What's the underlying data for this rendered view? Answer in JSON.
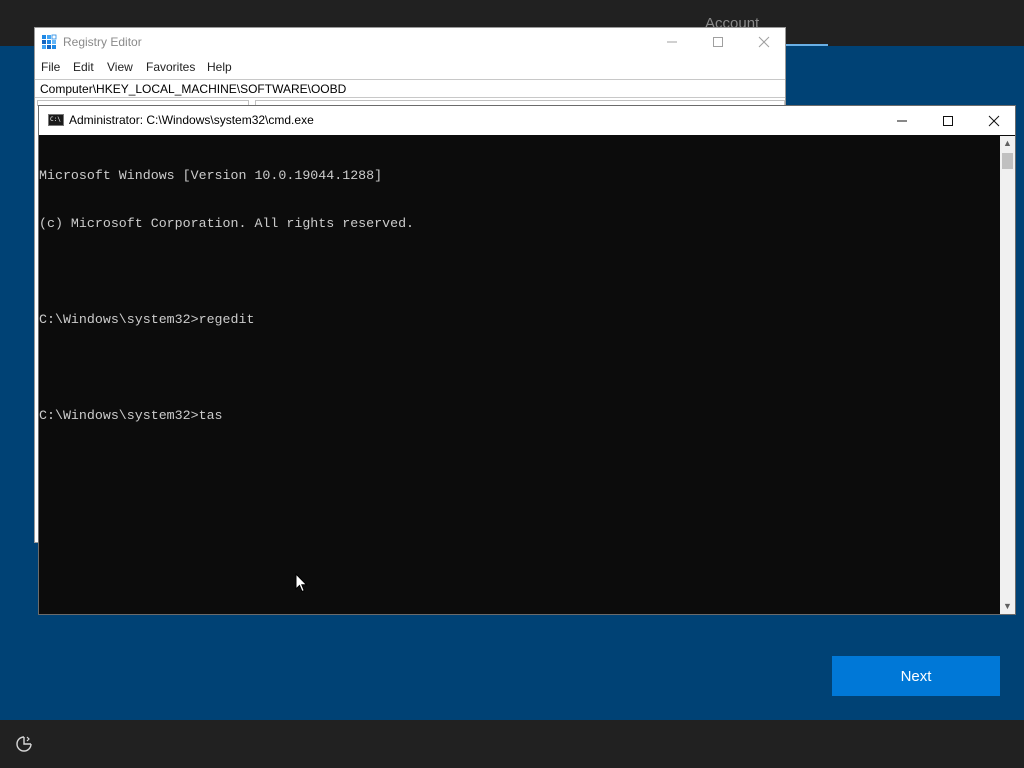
{
  "oobe": {
    "tab_label": "Account",
    "next_label": "Next",
    "icons": {
      "ease_of_access": "ease-of-access-icon"
    }
  },
  "regedit": {
    "title": "Registry Editor",
    "menu": [
      "File",
      "Edit",
      "View",
      "Favorites",
      "Help"
    ],
    "address": "Computer\\HKEY_LOCAL_MACHINE\\SOFTWARE\\OOBD",
    "icon": "registry-editor-icon"
  },
  "cmd": {
    "title": "Administrator: C:\\Windows\\system32\\cmd.exe",
    "lines": [
      "Microsoft Windows [Version 10.0.19044.1288]",
      "(c) Microsoft Corporation. All rights reserved.",
      "",
      "C:\\Windows\\system32>regedit",
      "",
      "C:\\Windows\\system32>tas"
    ],
    "icon": "cmd-icon"
  },
  "colors": {
    "oobe_background": "#004275",
    "oobe_bar": "#212121",
    "accent": "#0078d7",
    "console_bg": "#0c0c0c",
    "console_text": "#cccccc"
  }
}
